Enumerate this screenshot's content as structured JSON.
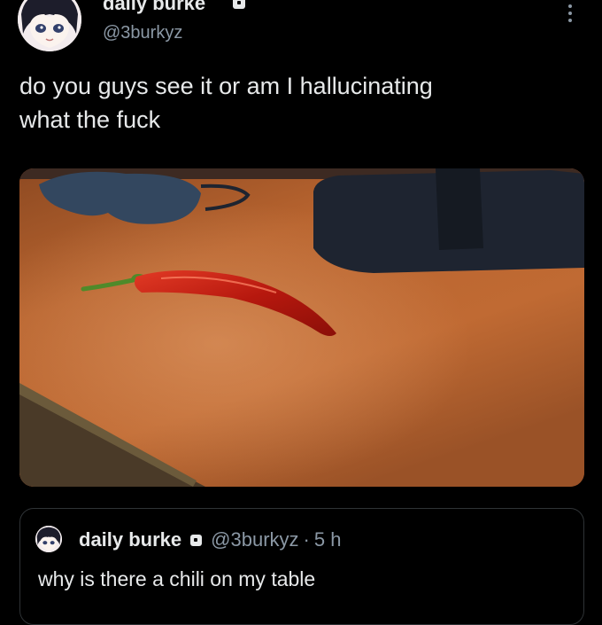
{
  "tweet": {
    "display_name": "daily burke",
    "handle": "@3burkyz",
    "text": "do you guys see it or am I hallucinating\nwhat the fuck",
    "more_icon": "more-vertical-icon",
    "lock_icon": "lock-icon"
  },
  "quoted_tweet": {
    "display_name": "daily burke",
    "handle": "@3burkyz",
    "separator": "·",
    "time": "5 h",
    "text": "why is there a chili on my table",
    "lock_icon": "lock-icon"
  },
  "colors": {
    "background": "#000000",
    "text": "#e7e9ea",
    "muted": "#8b98a5",
    "border": "#2f3336"
  }
}
